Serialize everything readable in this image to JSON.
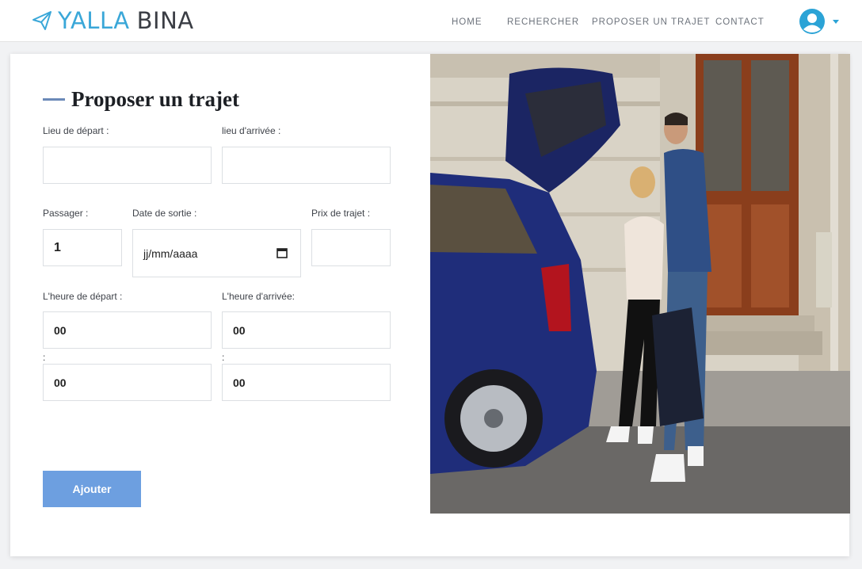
{
  "brand": {
    "first": "YALLA",
    "second": "BINA"
  },
  "nav": {
    "home": "HOME",
    "search": "RECHERCHER",
    "propose": "PROPOSER UN TRAJET",
    "contact": "CONTACT"
  },
  "form": {
    "title": "Proposer un trajet",
    "departure_label": "Lieu de départ :",
    "departure_value": "",
    "arrival_label": "lieu d'arrivée :",
    "arrival_value": "",
    "passengers_label": "Passager :",
    "passengers_value": "1",
    "date_label": "Date de sortie :",
    "date_value": "jj/mm/aaaa",
    "price_label": "Prix de trajet :",
    "price_value": "",
    "depart_time_label": "L'heure de départ :",
    "arrive_time_label": "L'heure d'arrivée:",
    "depart_hour": "00",
    "depart_minute": "00",
    "arrive_hour": "00",
    "arrive_minute": "00",
    "time_separator": ":",
    "submit_label": "Ajouter"
  },
  "colors": {
    "brand_blue": "#3aa7d8",
    "button": "#6d9fe0",
    "title_bar": "#6b89b8"
  },
  "icons": [
    "paper-plane-icon",
    "user-avatar-icon",
    "chevron-down-icon",
    "calendar-icon"
  ]
}
